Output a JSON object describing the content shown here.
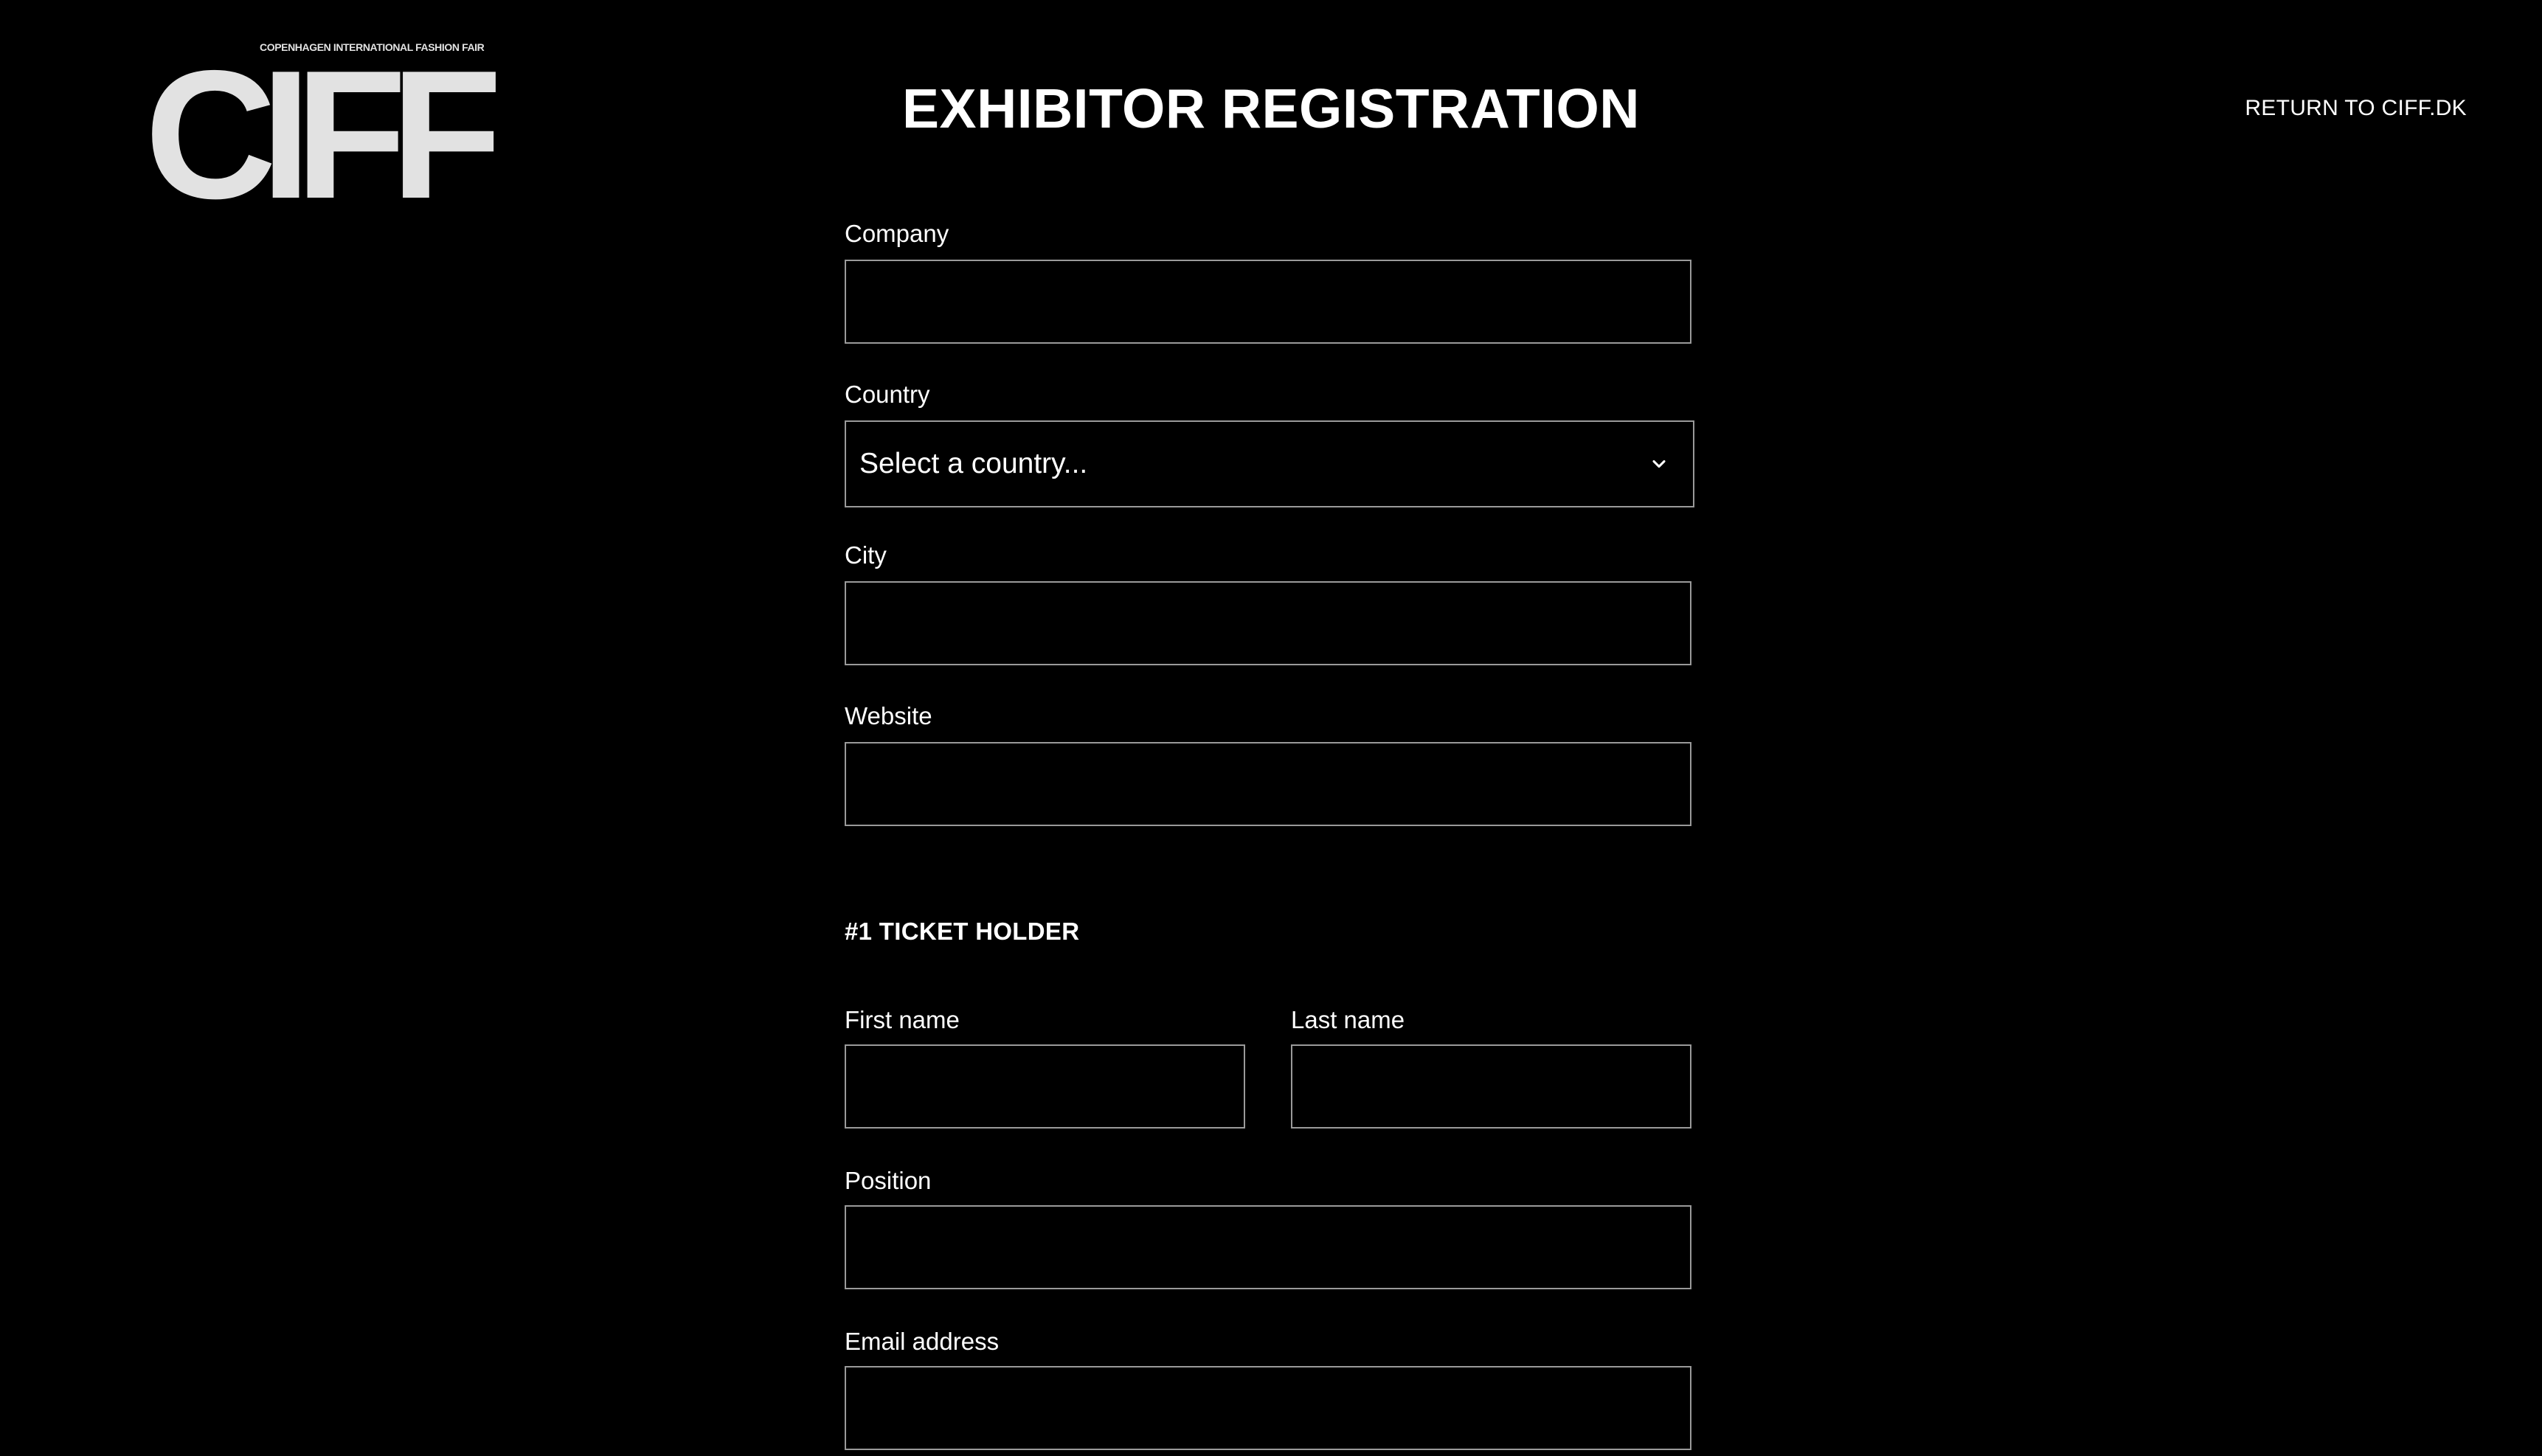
{
  "brand": {
    "tagline": "COPENHAGEN INTERNATIONAL FASHION FAIR",
    "wordmark": "CIFF"
  },
  "header": {
    "title": "EXHIBITOR REGISTRATION",
    "return_link": "RETURN TO CIFF.DK"
  },
  "form": {
    "company": {
      "label": "Company",
      "value": ""
    },
    "country": {
      "label": "Country",
      "selected": "Select a country..."
    },
    "city": {
      "label": "City",
      "value": ""
    },
    "website": {
      "label": "Website",
      "value": ""
    },
    "ticket_holder": {
      "heading": "#1 TICKET HOLDER",
      "first_name": {
        "label": "First name",
        "value": ""
      },
      "last_name": {
        "label": "Last name",
        "value": ""
      },
      "position": {
        "label": "Position",
        "value": ""
      },
      "email": {
        "label": "Email address",
        "value": ""
      }
    }
  },
  "colors": {
    "background": "#000000",
    "text": "#ffffff",
    "logo": "#e2e2e2",
    "field_border": "#9a9a9a"
  },
  "icons": {
    "country_select": "chevron-down-icon"
  }
}
